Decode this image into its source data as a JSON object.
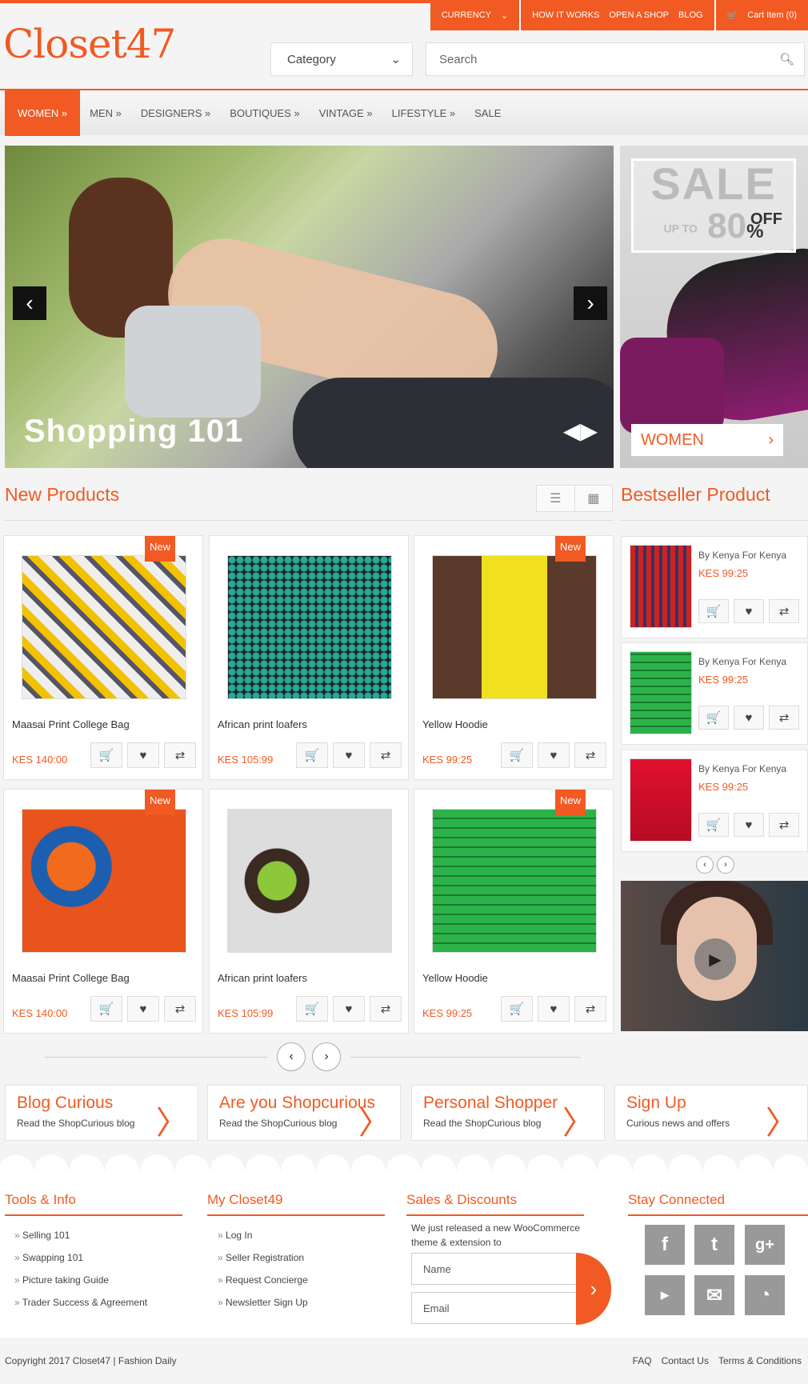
{
  "topbar": {
    "currency": "CURRENCY",
    "links": [
      "HOW IT WORKS",
      "OPEN A SHOP",
      "BLOG"
    ],
    "cart": "Cart Item (0)"
  },
  "brand": {
    "logo": "Closet47"
  },
  "search": {
    "category": "Category",
    "placeholder": "Search"
  },
  "nav": [
    "WOMEN »",
    "MEN »",
    "DESIGNERS »",
    "BOUTIQUES »",
    "VINTAGE »",
    "LIFESTYLE »",
    "SALE"
  ],
  "hero": {
    "caption": "Shopping 101"
  },
  "sale": {
    "big": "SALE",
    "upto": "UP TO",
    "pct": "80",
    "pctsign": "%",
    "off": "OFF",
    "label": "WOMEN"
  },
  "sections": {
    "new_products": "New Products",
    "bestseller": "Bestseller Product"
  },
  "products": [
    {
      "name": "Maasai Print College Bag",
      "price": "KES 140:00",
      "badge": "New"
    },
    {
      "name": "African print loafers",
      "price": "KES 105:99",
      "badge": ""
    },
    {
      "name": "Yellow Hoodie",
      "price": "KES 99:25",
      "badge": "New"
    },
    {
      "name": "Maasai Print College Bag",
      "price": "KES 140:00",
      "badge": "New"
    },
    {
      "name": "African print loafers",
      "price": "KES 105:99",
      "badge": ""
    },
    {
      "name": "Yellow Hoodie",
      "price": "KES 99:25",
      "badge": "New"
    }
  ],
  "bestsellers": [
    {
      "by": "By Kenya For Kenya",
      "price": "KES 99:25"
    },
    {
      "by": "By Kenya For Kenya",
      "price": "KES 99:25"
    },
    {
      "by": "By Kenya For Kenya",
      "price": "KES 99:25"
    }
  ],
  "promos": [
    {
      "title": "Blog Curious",
      "sub": "Read the ShopCurious blog"
    },
    {
      "title": "Are you Shopcurious",
      "sub": "Read the ShopCurious blog"
    },
    {
      "title": "Personal Shopper",
      "sub": "Read the ShopCurious blog"
    },
    {
      "title": "Sign Up",
      "sub": "Curious news and offers"
    }
  ],
  "footer": {
    "tools_title": "Tools & Info",
    "tools": [
      "Selling 101",
      "Swapping 101",
      "Picture taking Guide",
      "Trader Success & Agreement"
    ],
    "my_title": "My Closet49",
    "my": [
      "Log In",
      "Seller Registration",
      "Request Concierge",
      "Newsletter Sign Up"
    ],
    "sales_title": "Sales & Discounts",
    "sales_text": "We just released a new WooCommerce theme & extension to",
    "name_placeholder": "Name",
    "email_placeholder": "Email",
    "stay_title": "Stay Connected",
    "copyright": "Copyright 2017 Closet47 | Fashion Daily",
    "links": [
      "FAQ",
      "Contact Us",
      "Terms & Conditions"
    ]
  },
  "colors": {
    "accent": "#f15a22"
  }
}
